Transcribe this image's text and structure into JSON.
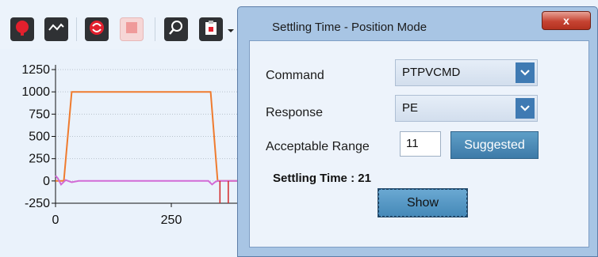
{
  "toolbar": {
    "icons": [
      "record-icon",
      "signal-icon",
      "refresh-icon",
      "stop-icon",
      "zoom-icon",
      "clipboard-icon",
      "chevron-down-icon"
    ]
  },
  "chart_data": {
    "type": "line",
    "y_ticks": [
      "1250",
      "1000",
      "750",
      "500",
      "250",
      "0",
      "-250"
    ],
    "x_ticks": [
      "0",
      "250"
    ],
    "ylim": [
      -250,
      1250
    ],
    "grid": true,
    "series": [
      {
        "color": "#ef7b2e",
        "x": [
          0,
          18,
          35,
          335,
          350,
          370,
          430
        ],
        "y": [
          0,
          0,
          1000,
          1000,
          0,
          0,
          0
        ]
      },
      {
        "color": "#d26ad6",
        "x": [
          0,
          5,
          12,
          22,
          35,
          50,
          330,
          338,
          345,
          350,
          360,
          430
        ],
        "y": [
          60,
          30,
          -40,
          10,
          -15,
          0,
          0,
          -40,
          -10,
          0,
          0,
          0
        ]
      },
      {
        "color": "#d32626",
        "markers_x": [
          355,
          373
        ]
      }
    ]
  },
  "dialog": {
    "title": "Settling Time - Position Mode",
    "close_label": "x",
    "command_label": "Command",
    "command_value": "PTPVCMD",
    "response_label": "Response",
    "response_value": "PE",
    "range_label": "Acceptable Range",
    "range_value": "11",
    "suggested_label": "Suggested",
    "settling_text": "Settling Time : 21",
    "show_label": "Show"
  }
}
